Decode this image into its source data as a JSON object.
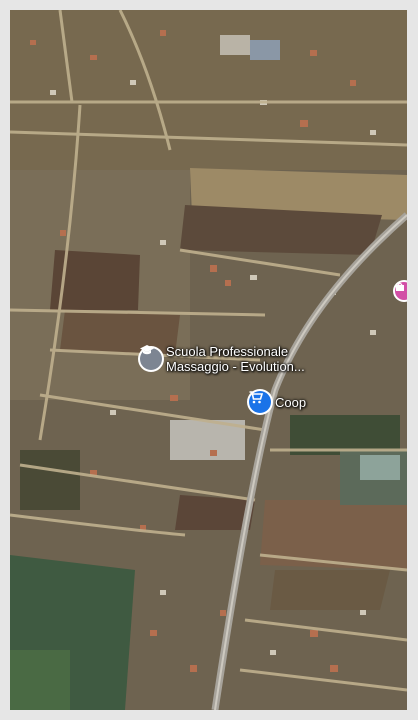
{
  "map": {
    "type": "satellite",
    "pois": [
      {
        "id": "school",
        "name_line1": "Scuola Professionale",
        "name_line2": "Massaggio - Evolution...",
        "icon": "graduation-cap-icon",
        "color": "#7d8592"
      },
      {
        "id": "coop",
        "name": "Coop",
        "icon": "shopping-cart-icon",
        "color": "#1a73e8"
      },
      {
        "id": "edge",
        "icon": "shopping-bag-icon",
        "color": "#d24fa6"
      }
    ]
  }
}
